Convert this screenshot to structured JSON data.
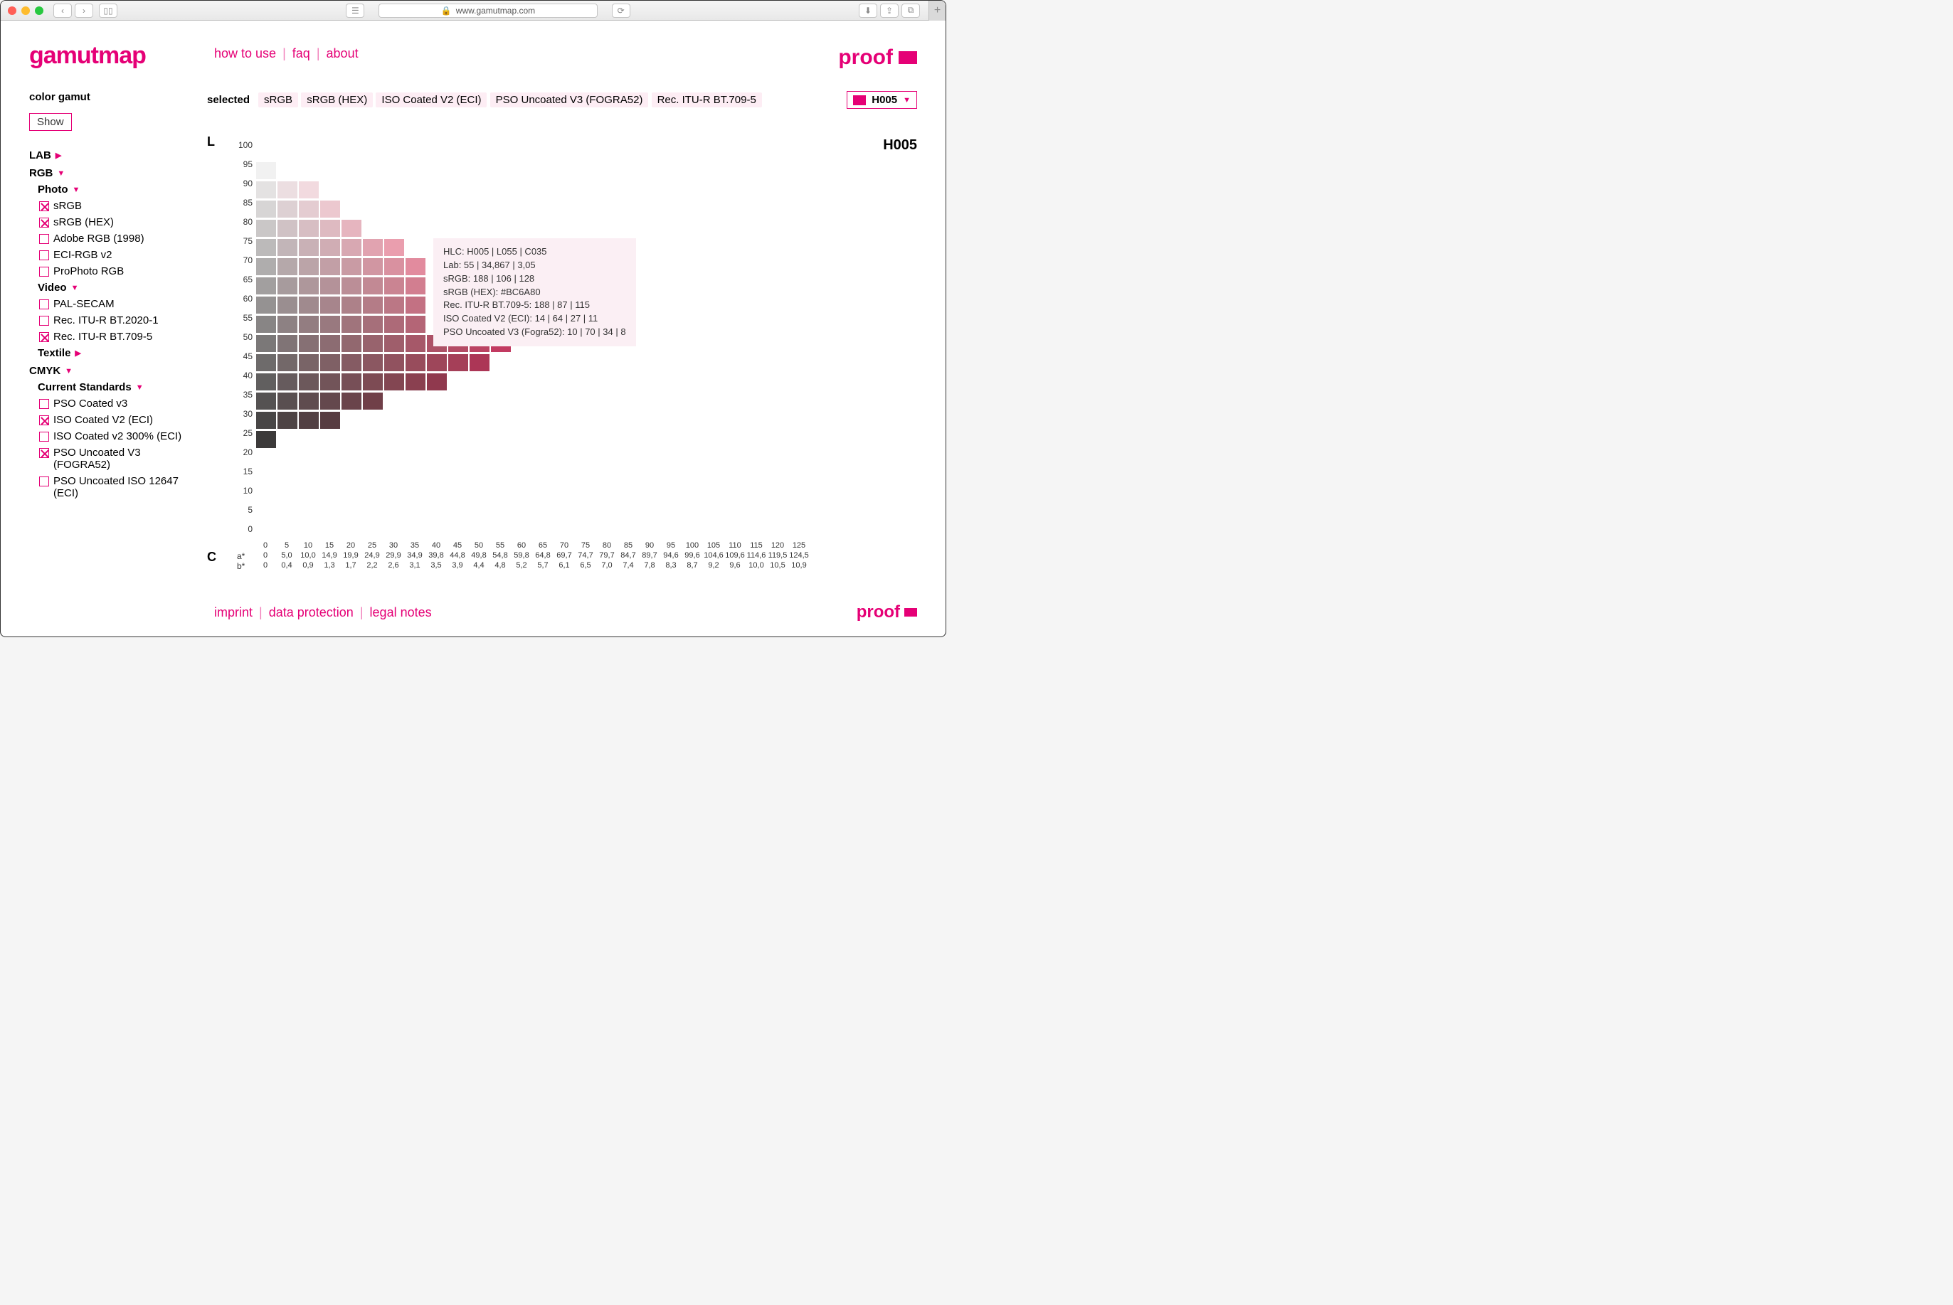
{
  "browser": {
    "url_display": "www.gamutmap.com",
    "lock": "🔒"
  },
  "logo_left": "gamutmap",
  "logo_right": "proof",
  "nav": {
    "how": "how to use",
    "faq": "faq",
    "about": "about"
  },
  "selected_label": "selected",
  "selected_chips": [
    "sRGB",
    "sRGB (HEX)",
    "ISO Coated V2 (ECI)",
    "PSO Uncoated V3 (FOGRA52)",
    "Rec. ITU-R BT.709-5"
  ],
  "hue_sel": "H005",
  "axis_L": "L",
  "axis_C": "C",
  "axis_a": "a*",
  "axis_b": "b*",
  "hue_title": "H005",
  "sidebar": {
    "title": "color gamut",
    "show": "Show",
    "lab": "LAB",
    "rgb": "RGB",
    "photo": "Photo",
    "video": "Video",
    "textile": "Textile",
    "cmyk": "CMYK",
    "cstd": "Current Standards",
    "opts": {
      "srgb": "sRGB",
      "srgbhex": "sRGB (HEX)",
      "adobe": "Adobe RGB (1998)",
      "ecirgb": "ECI-RGB v2",
      "prophoto": "ProPhoto RGB",
      "pal": "PAL-SECAM",
      "bt2020": "Rec. ITU-R BT.2020-1",
      "bt709": "Rec. ITU-R BT.709-5",
      "psoc3": "PSO Coated v3",
      "isoc2": "ISO Coated V2 (ECI)",
      "isoc2_300": "ISO Coated v2 300% (ECI)",
      "psou3": "PSO Uncoated V3 (FOGRA52)",
      "psou12647": "PSO Uncoated ISO 12647 (ECI)"
    }
  },
  "tooltip": {
    "l1": "HLC: H005 | L055 | C035",
    "l2": "Lab: 55 | 34,867 | 3,05",
    "l3": "sRGB: 188 | 106 | 128",
    "l4": "sRGB (HEX): #BC6A80",
    "l5": "Rec. ITU-R BT.709-5: 188 | 87 | 115",
    "l6": "ISO Coated V2 (ECI): 14 | 64 | 27 | 11",
    "l7": "PSO Uncoated V3 (Fogra52): 10 | 70 | 34 | 8"
  },
  "footer": {
    "imprint": "imprint",
    "dp": "data protection",
    "ln": "legal notes"
  },
  "chart_data": {
    "type": "heatmap",
    "title": "H005",
    "xlabel": "C",
    "ylabel": "L",
    "y_ticks": [
      100,
      95,
      90,
      85,
      80,
      75,
      70,
      65,
      60,
      55,
      50,
      45,
      40,
      35,
      30,
      25,
      20,
      15,
      10,
      5,
      0
    ],
    "x_C": [
      0,
      5,
      10,
      15,
      20,
      25,
      30,
      35,
      40,
      45,
      50,
      55,
      60,
      65,
      70,
      75,
      80,
      85,
      90,
      95,
      100,
      105,
      110,
      115,
      120,
      125
    ],
    "x_a": [
      0,
      "5,0",
      "10,0",
      "14,9",
      "19,9",
      "24,9",
      "29,9",
      "34,9",
      "39,8",
      "44,8",
      "49,8",
      "54,8",
      "59,8",
      "64,8",
      "69,7",
      "74,7",
      "79,7",
      "84,7",
      "89,7",
      "94,6",
      "99,6",
      "104,6",
      "109,6",
      "114,6",
      "119,5",
      "124,5"
    ],
    "x_b": [
      0,
      "0,4",
      "0,9",
      "1,3",
      "1,7",
      "2,2",
      "2,6",
      "3,1",
      "3,5",
      "3,9",
      "4,4",
      "4,8",
      "5,2",
      "5,7",
      "6,1",
      "6,5",
      "7,0",
      "7,4",
      "7,8",
      "8,3",
      "8,7",
      "9,2",
      "9,6",
      "10,0",
      "10,5",
      "10,9"
    ],
    "cells": [
      {
        "L": 95,
        "C": 0,
        "hex": "#f1f1f1"
      },
      {
        "L": 90,
        "C": 0,
        "hex": "#e4e2e2"
      },
      {
        "L": 90,
        "C": 5,
        "hex": "#ecdee1"
      },
      {
        "L": 90,
        "C": 10,
        "hex": "#f2dadf"
      },
      {
        "L": 85,
        "C": 0,
        "hex": "#d7d5d5"
      },
      {
        "L": 85,
        "C": 5,
        "hex": "#ddd0d3"
      },
      {
        "L": 85,
        "C": 10,
        "hex": "#e4ccd1"
      },
      {
        "L": 85,
        "C": 15,
        "hex": "#ecc8cf"
      },
      {
        "L": 80,
        "C": 0,
        "hex": "#cac7c7"
      },
      {
        "L": 80,
        "C": 5,
        "hex": "#d0c2c5"
      },
      {
        "L": 80,
        "C": 10,
        "hex": "#d7bec3"
      },
      {
        "L": 80,
        "C": 15,
        "hex": "#debac1"
      },
      {
        "L": 80,
        "C": 20,
        "hex": "#e6b5bf"
      },
      {
        "L": 75,
        "C": 0,
        "hex": "#bcbaba"
      },
      {
        "L": 75,
        "C": 5,
        "hex": "#c2b5b8"
      },
      {
        "L": 75,
        "C": 10,
        "hex": "#c9b1b6"
      },
      {
        "L": 75,
        "C": 15,
        "hex": "#d0adb4"
      },
      {
        "L": 75,
        "C": 20,
        "hex": "#d8a8b2"
      },
      {
        "L": 75,
        "C": 25,
        "hex": "#e1a3b0"
      },
      {
        "L": 75,
        "C": 30,
        "hex": "#ea9eae"
      },
      {
        "L": 70,
        "C": 0,
        "hex": "#afadad"
      },
      {
        "L": 70,
        "C": 5,
        "hex": "#b5a8aa"
      },
      {
        "L": 70,
        "C": 10,
        "hex": "#bba4a8"
      },
      {
        "L": 70,
        "C": 15,
        "hex": "#c29fa6"
      },
      {
        "L": 70,
        "C": 20,
        "hex": "#c99ba4"
      },
      {
        "L": 70,
        "C": 25,
        "hex": "#d196a2"
      },
      {
        "L": 70,
        "C": 30,
        "hex": "#d991a0"
      },
      {
        "L": 70,
        "C": 35,
        "hex": "#e28b9e"
      },
      {
        "L": 65,
        "C": 0,
        "hex": "#a29f9f"
      },
      {
        "L": 65,
        "C": 5,
        "hex": "#a79b9d"
      },
      {
        "L": 65,
        "C": 10,
        "hex": "#ae979b"
      },
      {
        "L": 65,
        "C": 15,
        "hex": "#b49299"
      },
      {
        "L": 65,
        "C": 20,
        "hex": "#bb8e97"
      },
      {
        "L": 65,
        "C": 25,
        "hex": "#c28994"
      },
      {
        "L": 65,
        "C": 30,
        "hex": "#ca8492"
      },
      {
        "L": 65,
        "C": 35,
        "hex": "#d27e90"
      },
      {
        "L": 60,
        "C": 0,
        "hex": "#959292"
      },
      {
        "L": 60,
        "C": 5,
        "hex": "#9a8e90"
      },
      {
        "L": 60,
        "C": 10,
        "hex": "#a08a8e"
      },
      {
        "L": 60,
        "C": 15,
        "hex": "#a7858c"
      },
      {
        "L": 60,
        "C": 20,
        "hex": "#ad8189"
      },
      {
        "L": 60,
        "C": 25,
        "hex": "#b47c87"
      },
      {
        "L": 60,
        "C": 30,
        "hex": "#bb7785"
      },
      {
        "L": 60,
        "C": 35,
        "hex": "#c37183"
      },
      {
        "L": 55,
        "C": 0,
        "hex": "#888585"
      },
      {
        "L": 55,
        "C": 5,
        "hex": "#8d8183"
      },
      {
        "L": 55,
        "C": 10,
        "hex": "#937d81"
      },
      {
        "L": 55,
        "C": 15,
        "hex": "#99797f"
      },
      {
        "L": 55,
        "C": 20,
        "hex": "#a0747c"
      },
      {
        "L": 55,
        "C": 25,
        "hex": "#a66f7a"
      },
      {
        "L": 55,
        "C": 30,
        "hex": "#ad6a78"
      },
      {
        "L": 55,
        "C": 35,
        "hex": "#b46576"
      },
      {
        "L": 50,
        "C": 0,
        "hex": "#7b7878"
      },
      {
        "L": 50,
        "C": 5,
        "hex": "#807476"
      },
      {
        "L": 50,
        "C": 10,
        "hex": "#867074"
      },
      {
        "L": 50,
        "C": 15,
        "hex": "#8c6c72"
      },
      {
        "L": 50,
        "C": 20,
        "hex": "#92686f"
      },
      {
        "L": 50,
        "C": 25,
        "hex": "#98636d"
      },
      {
        "L": 50,
        "C": 30,
        "hex": "#9f5e6b"
      },
      {
        "L": 50,
        "C": 35,
        "hex": "#a65869"
      },
      {
        "L": 50,
        "C": 40,
        "hex": "#ad5267"
      },
      {
        "L": 50,
        "C": 45,
        "hex": "#b44b65"
      },
      {
        "L": 50,
        "C": 50,
        "hex": "#bb4363"
      },
      {
        "L": 50,
        "C": 55,
        "hex": "#c23a61"
      },
      {
        "L": 45,
        "C": 0,
        "hex": "#6e6b6b"
      },
      {
        "L": 45,
        "C": 5,
        "hex": "#736869"
      },
      {
        "L": 45,
        "C": 10,
        "hex": "#796467"
      },
      {
        "L": 45,
        "C": 15,
        "hex": "#7f6065"
      },
      {
        "L": 45,
        "C": 20,
        "hex": "#855b63"
      },
      {
        "L": 45,
        "C": 25,
        "hex": "#8b5761"
      },
      {
        "L": 45,
        "C": 30,
        "hex": "#91525f"
      },
      {
        "L": 45,
        "C": 35,
        "hex": "#984c5c"
      },
      {
        "L": 45,
        "C": 40,
        "hex": "#9e465a"
      },
      {
        "L": 45,
        "C": 45,
        "hex": "#a53f58"
      },
      {
        "L": 45,
        "C": 50,
        "hex": "#ac3656"
      },
      {
        "L": 40,
        "C": 0,
        "hex": "#615f5f"
      },
      {
        "L": 40,
        "C": 5,
        "hex": "#665b5d"
      },
      {
        "L": 40,
        "C": 10,
        "hex": "#6c585b"
      },
      {
        "L": 40,
        "C": 15,
        "hex": "#725459"
      },
      {
        "L": 40,
        "C": 20,
        "hex": "#774f57"
      },
      {
        "L": 40,
        "C": 25,
        "hex": "#7d4b54"
      },
      {
        "L": 40,
        "C": 30,
        "hex": "#834652"
      },
      {
        "L": 40,
        "C": 35,
        "hex": "#8a4050"
      },
      {
        "L": 40,
        "C": 40,
        "hex": "#90394e"
      },
      {
        "L": 35,
        "C": 0,
        "hex": "#555252"
      },
      {
        "L": 35,
        "C": 5,
        "hex": "#594f50"
      },
      {
        "L": 35,
        "C": 10,
        "hex": "#5f4c4f"
      },
      {
        "L": 35,
        "C": 15,
        "hex": "#64484d"
      },
      {
        "L": 35,
        "C": 20,
        "hex": "#6a444b"
      },
      {
        "L": 35,
        "C": 25,
        "hex": "#703f48"
      },
      {
        "L": 30,
        "C": 0,
        "hex": "#484646"
      },
      {
        "L": 30,
        "C": 5,
        "hex": "#4d4344"
      },
      {
        "L": 30,
        "C": 10,
        "hex": "#524043"
      },
      {
        "L": 30,
        "C": 15,
        "hex": "#573c41"
      },
      {
        "L": 25,
        "C": 0,
        "hex": "#3c3a3a"
      }
    ],
    "tooltip_cell": {
      "L": 55,
      "C": 35
    }
  }
}
